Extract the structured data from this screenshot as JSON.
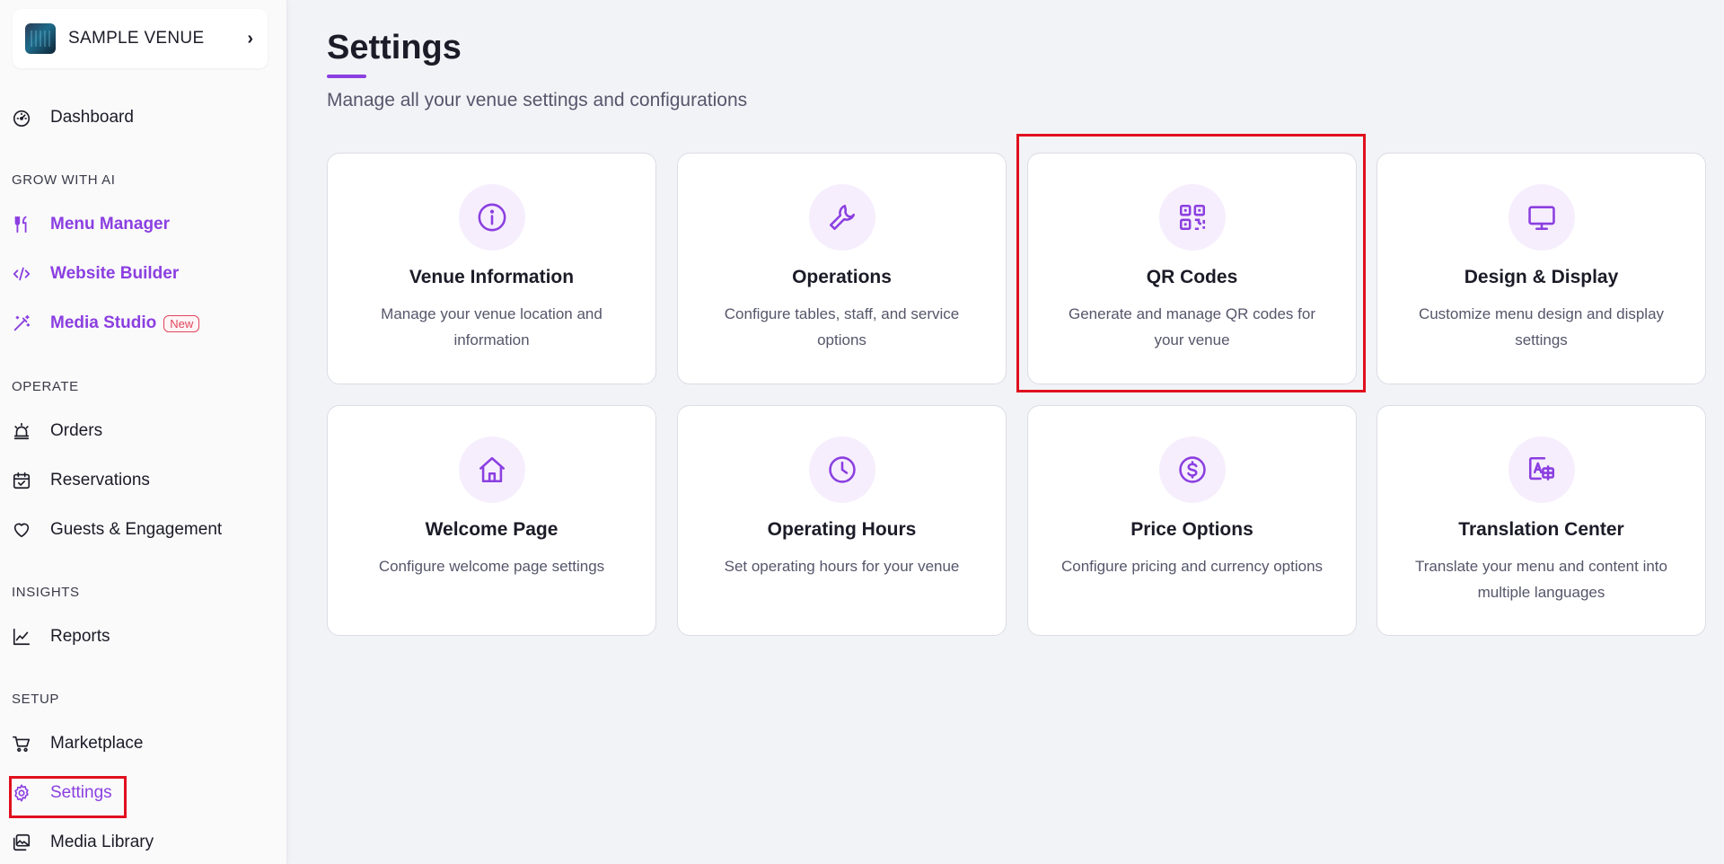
{
  "sidebar": {
    "venue_name": "SAMPLE VENUE",
    "chevron": "›",
    "dashboard": "Dashboard",
    "sections": {
      "grow": "GROW WITH AI",
      "operate": "OPERATE",
      "insights": "INSIGHTS",
      "setup": "SETUP"
    },
    "items": {
      "menu_manager": "Menu Manager",
      "website_builder": "Website Builder",
      "media_studio": "Media Studio",
      "media_studio_badge": "New",
      "orders": "Orders",
      "reservations": "Reservations",
      "guests": "Guests & Engagement",
      "reports": "Reports",
      "marketplace": "Marketplace",
      "settings": "Settings",
      "media_library": "Media Library"
    },
    "active_item": "Settings"
  },
  "main": {
    "title": "Settings",
    "subtitle": "Manage all your venue settings and configurations",
    "cards": [
      {
        "title": "Venue Information",
        "desc": "Manage your venue location and information",
        "icon": "info-icon"
      },
      {
        "title": "Operations",
        "desc": "Configure tables, staff, and service options",
        "icon": "wrench-icon"
      },
      {
        "title": "QR Codes",
        "desc": "Generate and manage QR codes for your venue",
        "icon": "qr-code-icon"
      },
      {
        "title": "Design & Display",
        "desc": "Customize menu design and display settings",
        "icon": "monitor-icon"
      },
      {
        "title": "Welcome Page",
        "desc": "Configure welcome page settings",
        "icon": "home-icon"
      },
      {
        "title": "Operating Hours",
        "desc": "Set operating hours for your venue",
        "icon": "clock-icon"
      },
      {
        "title": "Price Options",
        "desc": "Configure pricing and currency options",
        "icon": "dollar-icon"
      },
      {
        "title": "Translation Center",
        "desc": "Translate your menu and content into multiple languages",
        "icon": "translate-icon"
      }
    ]
  },
  "colors": {
    "accent": "#8b3fe0",
    "icon_bg": "#f6eefd",
    "highlight": "#e0101e",
    "badge": "#e0455a"
  }
}
